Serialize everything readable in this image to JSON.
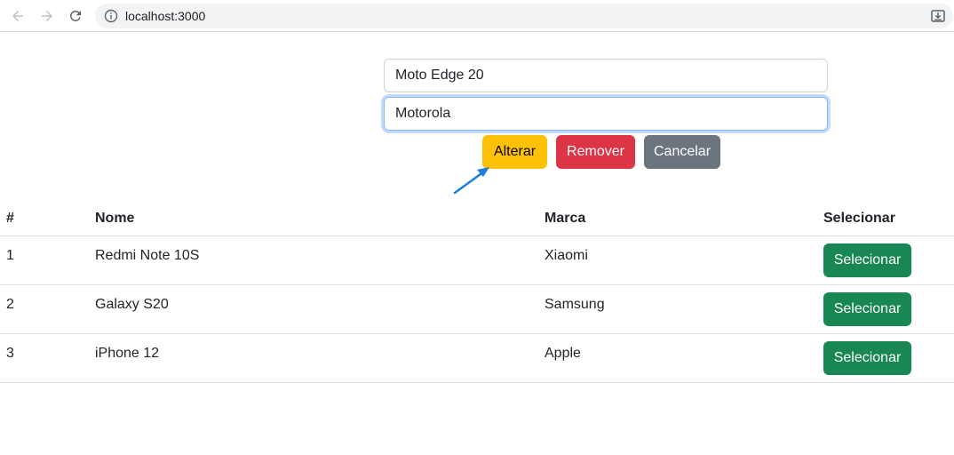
{
  "browser": {
    "url": "localhost:3000",
    "icons": [
      "back-arrow-icon",
      "forward-arrow-icon",
      "reload-icon",
      "info-icon",
      "install-app-icon"
    ]
  },
  "form": {
    "name_value": "Moto Edge 20",
    "brand_value": "Motorola",
    "buttons": {
      "alterar": "Alterar",
      "remover": "Remover",
      "cancelar": "Cancelar"
    }
  },
  "colors": {
    "warning": "#ffc107",
    "danger": "#dc3545",
    "secondary": "#6c757d",
    "success": "#198754",
    "arrow": "#1a7fe0"
  },
  "table": {
    "headers": [
      "#",
      "Nome",
      "Marca",
      "Selecionar"
    ],
    "rows": [
      {
        "id": "1",
        "nome": "Redmi Note 10S",
        "marca": "Xiaomi",
        "action": "Selecionar"
      },
      {
        "id": "2",
        "nome": "Galaxy S20",
        "marca": "Samsung",
        "action": "Selecionar"
      },
      {
        "id": "3",
        "nome": "iPhone 12",
        "marca": "Apple",
        "action": "Selecionar"
      }
    ]
  }
}
